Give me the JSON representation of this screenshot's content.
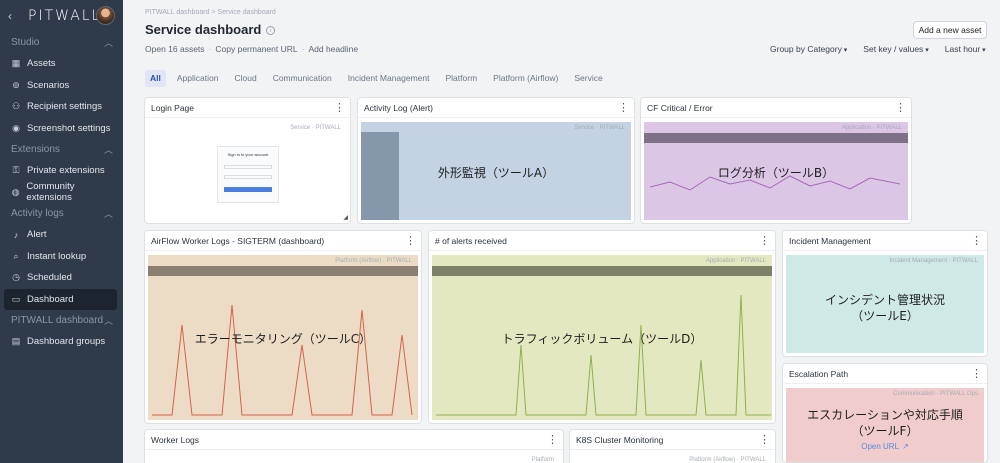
{
  "sidebar": {
    "logo": "PITWALL",
    "back_icon": "chevron-left-icon",
    "sections": [
      {
        "label": "Studio",
        "items": [
          {
            "label": "Assets",
            "icon": "grid-icon"
          },
          {
            "label": "Scenarios",
            "icon": "scenario-icon"
          },
          {
            "label": "Recipient settings",
            "icon": "user-settings-icon"
          },
          {
            "label": "Screenshot settings",
            "icon": "camera-icon"
          }
        ]
      },
      {
        "label": "Extensions",
        "items": [
          {
            "label": "Private extensions",
            "icon": "lock-icon"
          },
          {
            "label": "Community extensions",
            "icon": "globe-icon"
          }
        ]
      },
      {
        "label": "Activity logs",
        "items": [
          {
            "label": "Alert",
            "icon": "bell-icon"
          },
          {
            "label": "Instant lookup",
            "icon": "lookup-icon"
          },
          {
            "label": "Scheduled",
            "icon": "clock-icon"
          },
          {
            "label": "Dashboard",
            "icon": "dashboard-icon"
          }
        ]
      },
      {
        "label": "PITWALL dashboard",
        "items": [
          {
            "label": "Dashboard groups",
            "icon": "folder-icon"
          }
        ]
      }
    ]
  },
  "header": {
    "breadcrumb": "PITWALL dashboard  >  Service dashboard",
    "title": "Service dashboard",
    "add_button": "Add a new asset",
    "actions": [
      "Open 16 assets",
      "Copy permanent URL",
      "Add headline"
    ],
    "controls": [
      "Group by Category",
      "Set key / values",
      "Last hour"
    ]
  },
  "tabs": [
    "All",
    "Application",
    "Cloud",
    "Communication",
    "Incident Management",
    "Platform",
    "Platform (Airflow)",
    "Service"
  ],
  "panels": {
    "login": {
      "title": "Login Page",
      "label": "Service · PITWALL",
      "inner_title": "Sign in to your account"
    },
    "activity": {
      "title": "Activity Log (Alert)",
      "label": "Service · PITWALL",
      "overlay": "外形監視（ツールA）",
      "color": "#c3d3e3"
    },
    "cf": {
      "title": "CF Critical / Error",
      "label": "Application · PITWALL",
      "overlay": "ログ分析（ツールB）",
      "color": "#dcc6e6"
    },
    "airflow": {
      "title": "AirFlow Worker Logs - SIGTERM (dashboard)",
      "label": "Platform (Airflow) · PITWALL",
      "overlay": "エラーモニタリング（ツールC）",
      "color": "#ecdcc6"
    },
    "alerts": {
      "title": "# of alerts received",
      "label": "Application · PITWALL",
      "overlay": "トラフィックボリューム（ツールD）",
      "color": "#e4e8c0"
    },
    "incident": {
      "title": "Incident Management",
      "label": "Incident Management · PITWALL",
      "overlay1": "インシデント管理状況",
      "overlay2": "（ツールE）",
      "color": "#cfe9e6"
    },
    "escalation": {
      "title": "Escalation Path",
      "label": "Communication · PITWALL Ops",
      "overlay1": "エスカレーションや対応手順",
      "overlay2": "（ツールF）",
      "link": "Open URL",
      "color": "#f0cccc"
    },
    "worker": {
      "title": "Worker Logs",
      "label": "Platform"
    },
    "k8s": {
      "title": "K8S Cluster Monitoring",
      "label": "Platform (Airflow) · PITWALL"
    }
  }
}
